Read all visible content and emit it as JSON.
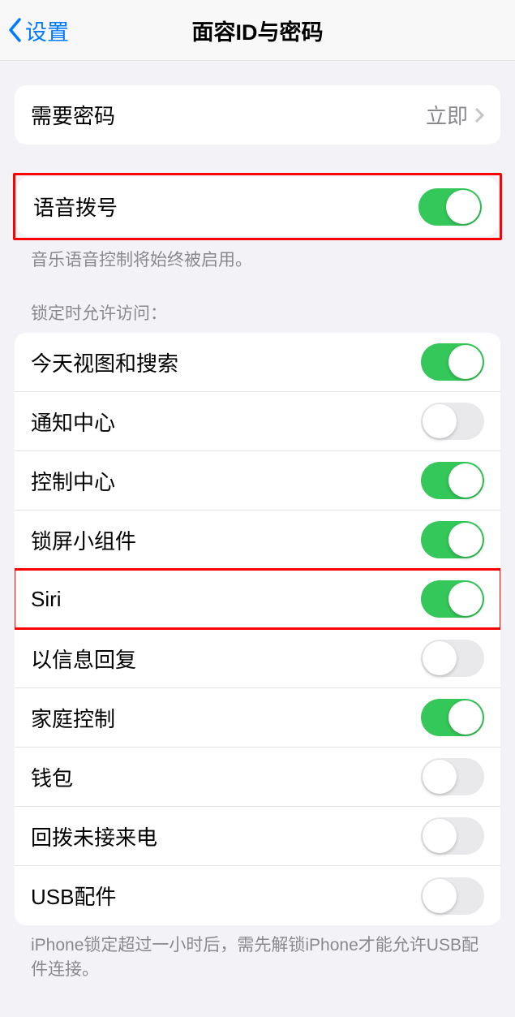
{
  "header": {
    "back_label": "设置",
    "title": "面容ID与密码"
  },
  "require_passcode": {
    "label": "需要密码",
    "value": "立即"
  },
  "voice_dial": {
    "label": "语音拨号",
    "footer": "音乐语音控制将始终被启用。",
    "on": true
  },
  "lock_access": {
    "header": "锁定时允许访问：",
    "items": [
      {
        "label": "今天视图和搜索",
        "on": true
      },
      {
        "label": "通知中心",
        "on": false
      },
      {
        "label": "控制中心",
        "on": true
      },
      {
        "label": "锁屏小组件",
        "on": true
      },
      {
        "label": "Siri",
        "on": true,
        "highlight": true
      },
      {
        "label": "以信息回复",
        "on": false
      },
      {
        "label": "家庭控制",
        "on": true
      },
      {
        "label": "钱包",
        "on": false
      },
      {
        "label": "回拨未接来电",
        "on": false
      },
      {
        "label": "USB配件",
        "on": false
      }
    ],
    "footer": "iPhone锁定超过一小时后，需先解锁iPhone才能允许USB配件连接。"
  }
}
